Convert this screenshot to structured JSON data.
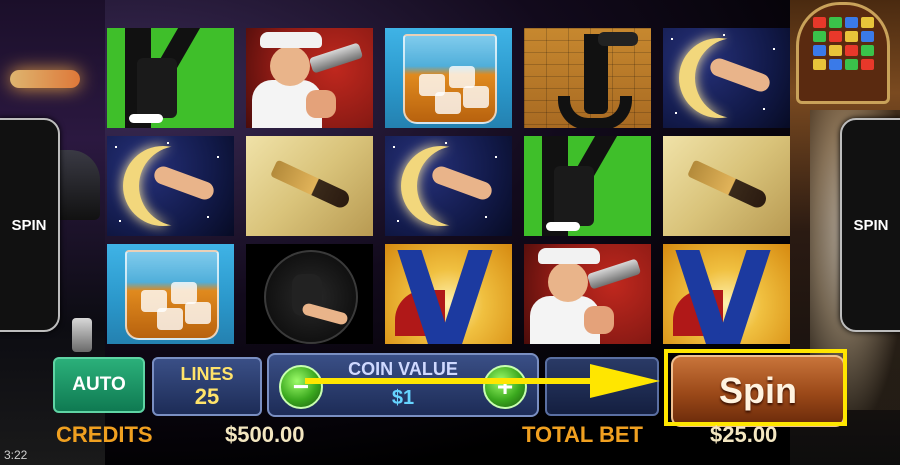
{
  "side_buttons": {
    "left_label": "SPIN",
    "right_label": "SPIN"
  },
  "reels": [
    [
      "k-gangster",
      "moon-leg",
      "whiskey-glass"
    ],
    [
      "gangster-gun",
      "bullet",
      "lady-moon"
    ],
    [
      "whiskey-glass",
      "moon-leg",
      "a-legs"
    ],
    [
      "j-gangster",
      "k-gangster",
      "gangster-gun"
    ],
    [
      "moon-leg",
      "bullet",
      "a-legs"
    ]
  ],
  "controls": {
    "auto_label": "AUTO",
    "lines_label": "LINES",
    "lines_value": "25",
    "coin_value_label": "COIN VALUE",
    "coin_value": "$1",
    "coin_minus_label": "−",
    "coin_plus_label": "+",
    "spin_label": "Spin"
  },
  "status": {
    "credits_label": "CREDITS",
    "credits_value": "$500.00",
    "total_bet_label": "TOTAL BET",
    "total_bet_value": "$25.00"
  },
  "clock": "3:22",
  "colors": {
    "highlight": "#ffe600",
    "label_gold": "#f0a020"
  }
}
